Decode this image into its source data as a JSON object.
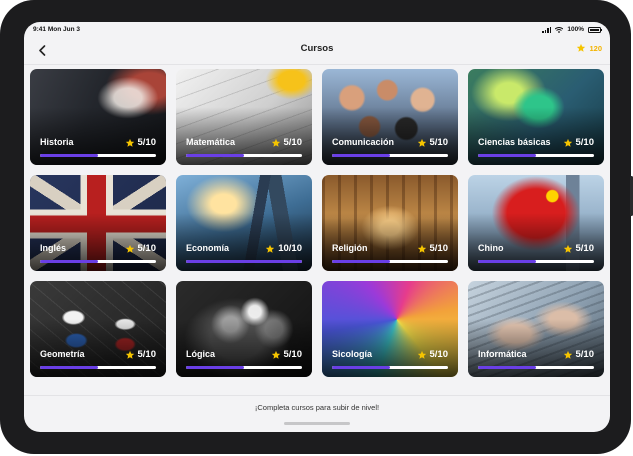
{
  "status": {
    "time": "9:41",
    "date": "Mon Jun 3",
    "battery": "100%"
  },
  "header": {
    "title": "Cursos",
    "coins": "120"
  },
  "footer": {
    "text": "¡Completa cursos para subir de nivel!"
  },
  "courses": [
    {
      "name": "Historia",
      "score": "5/10",
      "progress": 0.5
    },
    {
      "name": "Matemática",
      "score": "5/10",
      "progress": 0.5
    },
    {
      "name": "Comunicación",
      "score": "5/10",
      "progress": 0.5
    },
    {
      "name": "Ciencias básicas",
      "score": "5/10",
      "progress": 0.5
    },
    {
      "name": "Inglés",
      "score": "5/10",
      "progress": 0.5
    },
    {
      "name": "Economía",
      "score": "10/10",
      "progress": 1.0
    },
    {
      "name": "Religión",
      "score": "5/10",
      "progress": 0.5
    },
    {
      "name": "Chino",
      "score": "5/10",
      "progress": 0.5
    },
    {
      "name": "Geometría",
      "score": "5/10",
      "progress": 0.5
    },
    {
      "name": "Lógica",
      "score": "5/10",
      "progress": 0.5
    },
    {
      "name": "Sicología",
      "score": "5/10",
      "progress": 0.5
    },
    {
      "name": "Informática",
      "score": "5/10",
      "progress": 0.5
    }
  ],
  "colors": {
    "progress": "#6a3fe6",
    "star": "#f5c400",
    "coins": "#f3b400"
  },
  "icons": {
    "back": "chevron-left-icon",
    "coins": "star-icon",
    "score": "star-icon"
  }
}
